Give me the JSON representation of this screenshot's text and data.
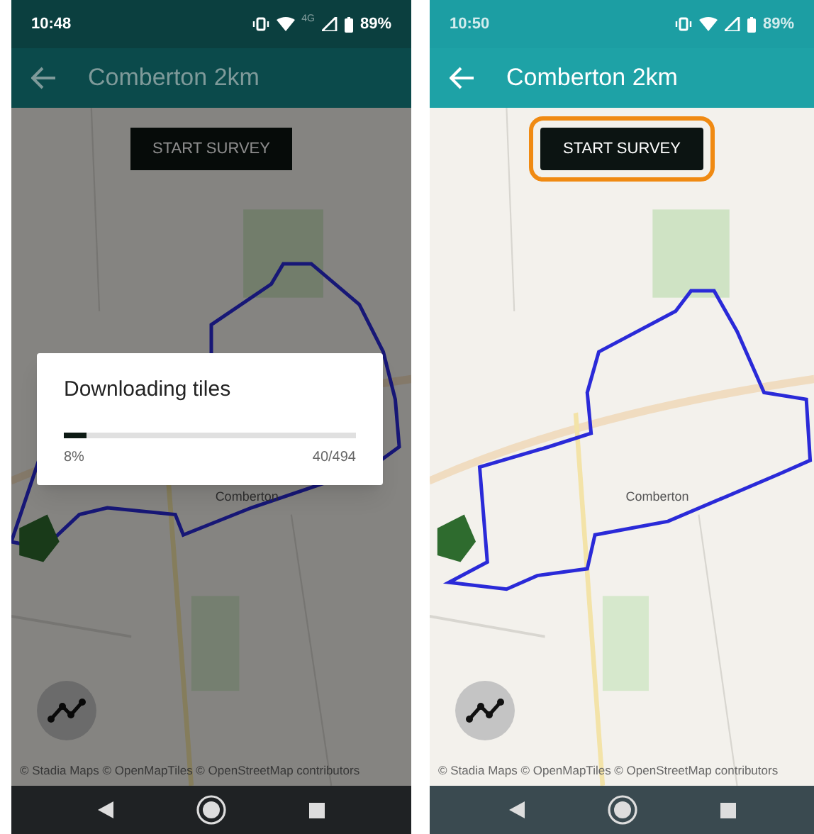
{
  "screens": [
    {
      "status": {
        "time": "10:48",
        "network": "4G",
        "battery": "89%"
      },
      "title": "Comberton 2km",
      "start_button": {
        "label": "START SURVEY",
        "highlighted": false
      },
      "map_labels": [
        "Comberton"
      ],
      "attribution": "© Stadia Maps © OpenMapTiles © OpenStreetMap contributors",
      "dialog": {
        "title": "Downloading tiles",
        "level": 0.08,
        "percent": "8%",
        "count": "40/494"
      }
    },
    {
      "status": {
        "time": "10:50",
        "battery": "89%"
      },
      "title": "Comberton 2km",
      "start_button": {
        "label": "START SURVEY",
        "highlighted": true
      },
      "map_labels": [
        "Comberton"
      ],
      "attribution": "© Stadia Maps © OpenMapTiles © OpenStreetMap contributors"
    }
  ]
}
